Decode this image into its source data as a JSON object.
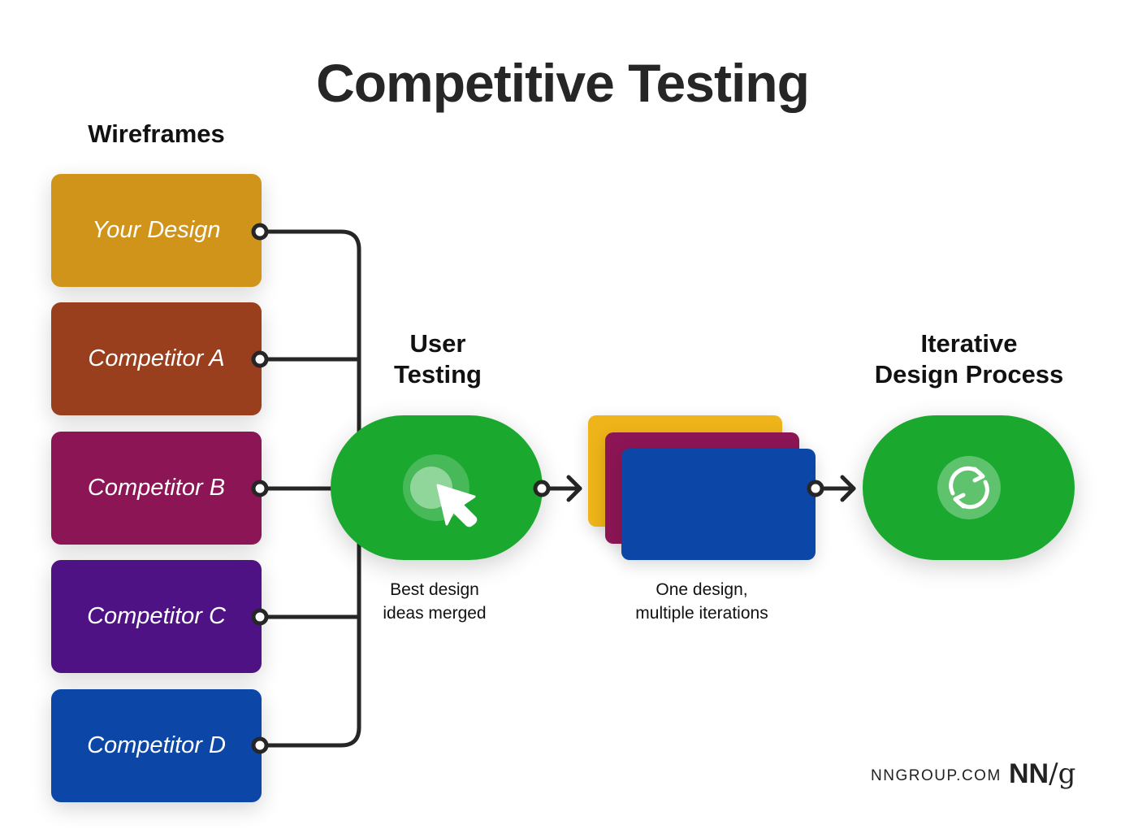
{
  "title": "Competitive Testing",
  "wireframes": {
    "heading": "Wireframes",
    "items": [
      {
        "label": "Your Design",
        "color": "#D0941A"
      },
      {
        "label": "Competitor A",
        "color": "#993F1E"
      },
      {
        "label": "Competitor B",
        "color": "#8C1555"
      },
      {
        "label": "Competitor C",
        "color": "#4E1285"
      },
      {
        "label": "Competitor D",
        "color": "#0C47A8"
      }
    ]
  },
  "user_testing": {
    "heading_line1": "User",
    "heading_line2": "Testing",
    "icon": "cursor-click-icon",
    "caption_line1": "Best design",
    "caption_line2": "ideas merged",
    "color": "#1AA82F"
  },
  "iterations": {
    "cards": [
      {
        "color": "#EEB419"
      },
      {
        "color": "#8C1555"
      },
      {
        "color": "#0C47A8"
      }
    ],
    "caption_line1": "One design,",
    "caption_line2": "multiple iterations"
  },
  "iterative_process": {
    "heading_line1": "Iterative",
    "heading_line2": "Design Process",
    "icon": "refresh-icon",
    "color": "#1AA82F"
  },
  "footer": {
    "site": "NNGROUP.COM",
    "logo_nn": "NN",
    "logo_slash": "/",
    "logo_g": "g"
  },
  "colors": {
    "connector": "#262626",
    "accent_green": "#1AA82F"
  }
}
